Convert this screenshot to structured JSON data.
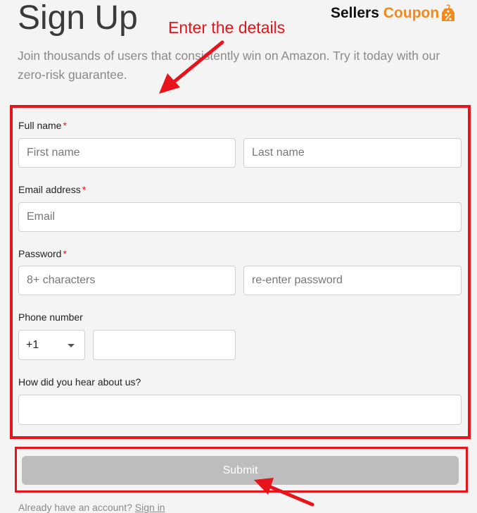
{
  "header": {
    "title": "Sign Up",
    "subtitle": "Join thousands of users that consistently win on Amazon. Try it today with our zero-risk guarantee."
  },
  "logo": {
    "word1": "Sellers",
    "word2": "Coupon",
    "icon": "price-tag-icon"
  },
  "annotation": {
    "text": "Enter the details",
    "color": "#e8141b"
  },
  "form": {
    "full_name": {
      "label": "Full name",
      "required_mark": "*",
      "first_placeholder": "First name",
      "last_placeholder": "Last name"
    },
    "email": {
      "label": "Email address",
      "required_mark": "*",
      "placeholder": "Email"
    },
    "password": {
      "label": "Password",
      "required_mark": "*",
      "placeholder": "8+ characters",
      "confirm_placeholder": "re-enter password"
    },
    "phone": {
      "label": "Phone number",
      "country_code": "+1",
      "value": ""
    },
    "referral": {
      "label": "How did you hear about us?",
      "value": ""
    },
    "submit_label": "Submit"
  },
  "footer": {
    "prompt": "Already have an account?",
    "signin_link": "Sign in"
  },
  "colors": {
    "accent": "#f08a1c",
    "annotation": "#e8141b",
    "button": "#bdbdbd"
  }
}
